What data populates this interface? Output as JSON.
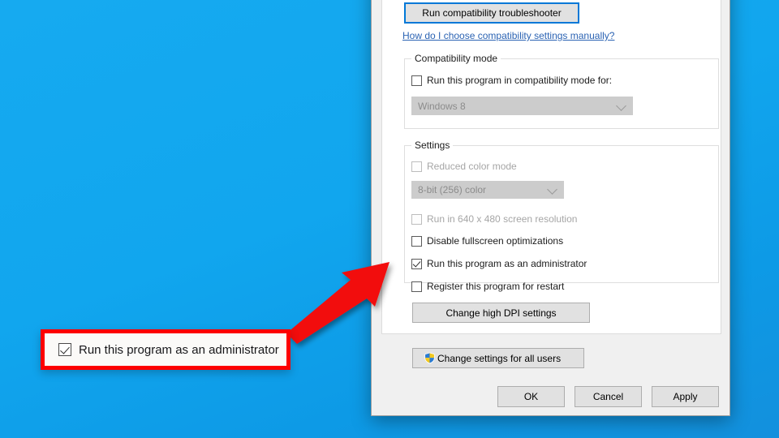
{
  "desktop": {
    "background_color": "#13a9f0"
  },
  "dialog": {
    "troubleshooter_button": "Run compatibility troubleshooter",
    "help_link": "How do I choose compatibility settings manually?",
    "compatibility_group": {
      "title": "Compatibility mode",
      "checkbox_label": "Run this program in compatibility mode for:",
      "checkbox_checked": false,
      "os_select_value": "Windows 8",
      "os_select_disabled": true
    },
    "settings_group": {
      "title": "Settings",
      "reduced_color_label": "Reduced color mode",
      "reduced_color_checked": false,
      "reduced_color_disabled": true,
      "color_depth_value": "8-bit (256) color",
      "color_depth_disabled": true,
      "low_resolution_label": "Run in 640 x 480 screen resolution",
      "low_resolution_checked": false,
      "low_resolution_disabled": true,
      "disable_fullscreen_label": "Disable fullscreen optimizations",
      "disable_fullscreen_checked": false,
      "run_as_admin_label": "Run this program as an administrator",
      "run_as_admin_checked": true,
      "register_restart_label": "Register this program for restart",
      "register_restart_checked": false,
      "dpi_button": "Change high DPI settings"
    },
    "all_users_button": "Change settings for all users",
    "footer": {
      "ok": "OK",
      "cancel": "Cancel",
      "apply": "Apply"
    }
  },
  "callout": {
    "label": "Run this program as an administrator",
    "checked": true,
    "border_color": "#fe0000",
    "arrow_color": "#f01010"
  }
}
